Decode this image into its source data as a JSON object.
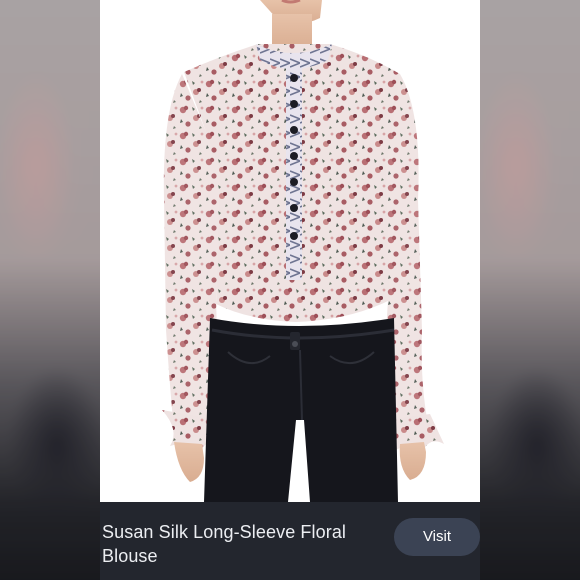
{
  "product": {
    "title": "Susan Silk Long-Sleeve Floral Blouse"
  },
  "actions": {
    "visit_label": "Visit"
  },
  "colors": {
    "info_bar": "#23262e",
    "visit_button": "#3b4354",
    "title_text": "#eceef2",
    "photo_background": "#ffffff"
  },
  "icons": {
    "product_image": "floral-blouse-photo"
  }
}
